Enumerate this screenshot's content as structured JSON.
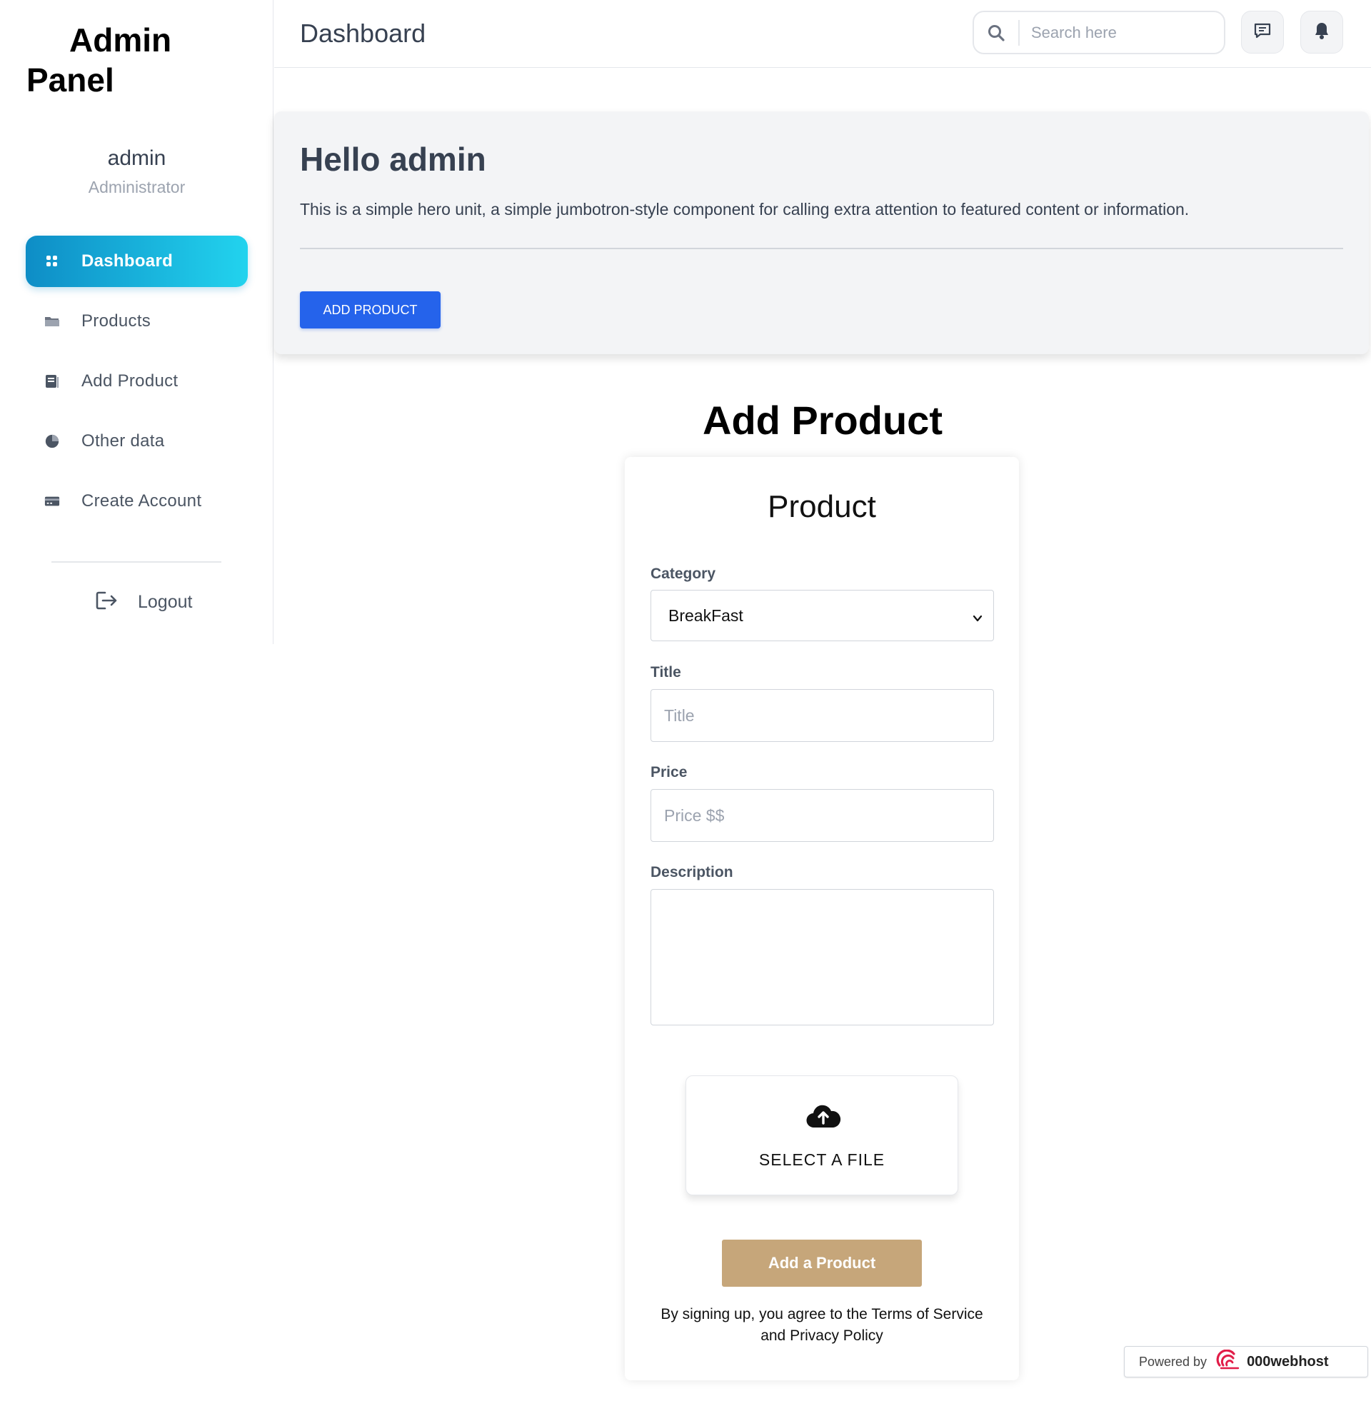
{
  "app": {
    "brand_line1": "Admin",
    "brand_line2": "Panel"
  },
  "user": {
    "name": "admin",
    "role": "Administrator"
  },
  "sidebar": {
    "items": [
      {
        "label": "Dashboard",
        "icon": "grid-icon",
        "active": true
      },
      {
        "label": "Products",
        "icon": "folder-icon",
        "active": false
      },
      {
        "label": "Add Product",
        "icon": "document-icon",
        "active": false
      },
      {
        "label": "Other data",
        "icon": "pie-chart-icon",
        "active": false
      },
      {
        "label": "Create Account",
        "icon": "credit-card-icon",
        "active": false
      }
    ],
    "logout_label": "Logout"
  },
  "header": {
    "title": "Dashboard",
    "search_placeholder": "Search here"
  },
  "hero": {
    "heading": "Hello admin",
    "text": "This is a simple hero unit, a simple jumbotron-style component for calling extra attention to featured content or information.",
    "button_label": "ADD PRODUCT"
  },
  "form": {
    "section_title": "Add Product",
    "card_title": "Product",
    "category_label": "Category",
    "category_value": "BreakFast",
    "title_label": "Title",
    "title_placeholder": "Title",
    "price_label": "Price",
    "price_placeholder": "Price $$",
    "description_label": "Description",
    "upload_label": "SELECT A FILE",
    "submit_label": "Add a Product",
    "terms_prefix": "By signing up, you agree to the",
    "terms_link": "Terms of Service",
    "terms_and": "and",
    "privacy_link": "Privacy Policy"
  },
  "badge": {
    "powered_by": "Powered by",
    "brand": "000webhost"
  },
  "colors": {
    "accent_blue": "#2563eb",
    "active_gradient_start": "#0e8dc6",
    "active_gradient_end": "#22d3ee",
    "submit_button": "#c6a67a"
  }
}
